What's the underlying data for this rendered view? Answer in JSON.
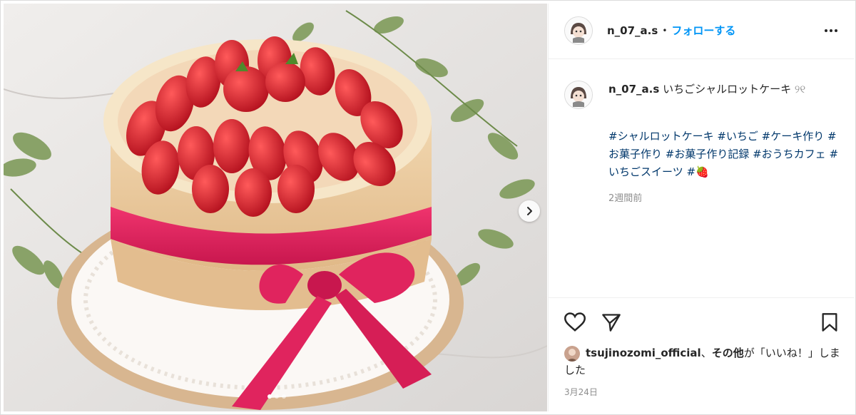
{
  "post": {
    "username": "n_07_a.s",
    "separator": "•",
    "follow_label": "フォローする",
    "more_icon": "more-dots-icon",
    "caption_text": "いちごシャルロットケーキ",
    "caption_emoji": "୨୧ ",
    "hashtags": "#シャルロットケーキ #いちご #ケーキ作り #お菓子作り #お菓子作り記録 #おうちカフェ #いちごスイーツ #🍓",
    "time_ago": "2週間前",
    "likes_user": "tsujinozomi_official",
    "likes_joiner": "、",
    "likes_others": "その他",
    "likes_suffix": "が「いいね！」しました",
    "date": "3月24日"
  },
  "carousel": {
    "dots": 3,
    "active_index": 0,
    "next_icon": "chevron-right-icon"
  },
  "actions": {
    "like_icon": "heart-icon",
    "share_icon": "send-icon",
    "save_icon": "bookmark-icon"
  },
  "colors": {
    "link": "#00376b",
    "follow": "#0095f6",
    "text": "#262626",
    "muted": "#8e8e8e",
    "ribbon": "#e0245e",
    "strawberry": "#d7202a"
  }
}
